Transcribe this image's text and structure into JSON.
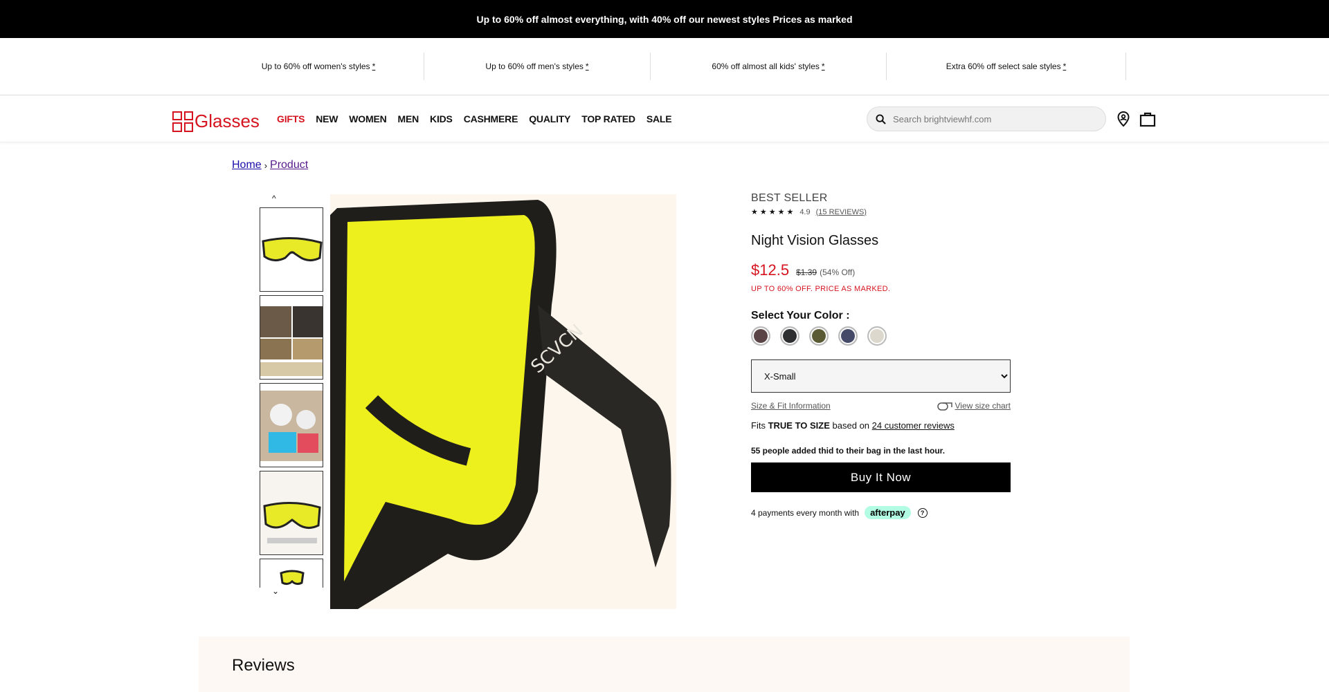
{
  "banner": {
    "text": "Up to 60% off almost everything, with 40% off our newest styles Prices as marked"
  },
  "promos": [
    {
      "text": "Up to 60% off women's styles",
      "mark": "*"
    },
    {
      "text": "Up to 60% off men's styles",
      "mark": "*"
    },
    {
      "text": "60% off almost all kids' styles",
      "mark": "*"
    },
    {
      "text": "Extra 60% off select sale styles",
      "mark": "*"
    }
  ],
  "nav": {
    "logo_text": "Glasses",
    "menu": [
      "GIFTS",
      "NEW",
      "WOMEN",
      "MEN",
      "KIDS",
      "CASHMERE",
      "QUALITY",
      "TOP RATED",
      "SALE"
    ],
    "search_placeholder": "Search brightviewhf.com",
    "icons": [
      "search-icon",
      "location-icon",
      "bag-icon"
    ]
  },
  "breadcrumb": {
    "home": "Home",
    "sep": "›",
    "current": "Product"
  },
  "gallery": {
    "up_arrow": "^",
    "down_arrow": "⌄",
    "thumb_count": 5
  },
  "product": {
    "badge": "BEST SELLER",
    "stars": "★★★★★",
    "rating": "4.9",
    "reviews_link": "(15 REVIEWS)",
    "title": "Night Vision Glasses",
    "price": "$12.5",
    "old_price": "$1.39",
    "discount": "(54% Off)",
    "sale_note": "UP TO 60% OFF. PRICE AS MARKED.",
    "color_label": "Select Your Color :",
    "colors": [
      "#5a4446",
      "#2e2f31",
      "#5a5b35",
      "#454a68",
      "#dcd8cd"
    ],
    "size_options": [
      "X-Small"
    ],
    "size_selected": "X-Small",
    "size_fit_link": "Size & Fit Information",
    "size_chart_link": "View size chart",
    "fit_prefix": "Fits",
    "fit_bold": "TRUE TO SIZE",
    "fit_mid": "based on",
    "fit_reviews": "24 customer reviews",
    "people_note": "55 people added thid to their bag in the last hour.",
    "buy_label": "Buy It Now",
    "pay_text": "4 payments every month with",
    "afterpay": "afterpay",
    "help": "?"
  },
  "reviews": {
    "title": "Reviews"
  },
  "colors": {
    "accent": "#d6141f",
    "banner_bg": "#000000",
    "afterpay_bg": "#b2fce4"
  }
}
